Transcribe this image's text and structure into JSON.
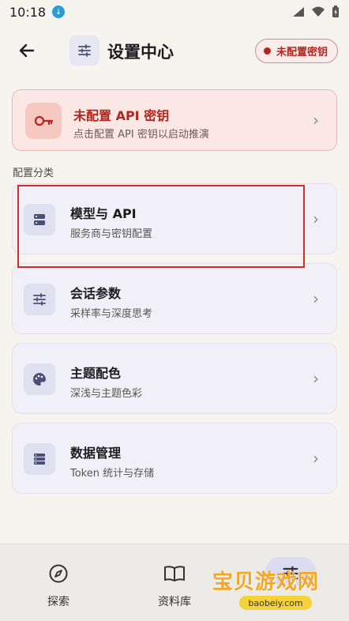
{
  "status_bar": {
    "time": "10:18"
  },
  "app_bar": {
    "title": "设置中心",
    "status_pill": "未配置密钥"
  },
  "warning": {
    "title": "未配置 API 密钥",
    "subtitle": "点击配置 API 密钥以启动推演"
  },
  "section_label": "配置分类",
  "categories": [
    {
      "title": "模型与 API",
      "subtitle": "服务商与密钥配置",
      "icon": "server-icon"
    },
    {
      "title": "会话参数",
      "subtitle": "采样率与深度思考",
      "icon": "sliders-icon"
    },
    {
      "title": "主题配色",
      "subtitle": "深浅与主题色彩",
      "icon": "palette-icon"
    },
    {
      "title": "数据管理",
      "subtitle": "Token 统计与存储",
      "icon": "storage-icon"
    }
  ],
  "bottom_nav": {
    "items": [
      {
        "label": "探索",
        "icon": "compass-icon"
      },
      {
        "label": "资料库",
        "icon": "book-icon"
      },
      {
        "label": "设置",
        "icon": "settings-sliders-icon",
        "active": true
      }
    ]
  },
  "watermark": {
    "text": "宝贝游戏网",
    "url": "baobeiy.com"
  },
  "colors": {
    "accent": "#b3261e",
    "card": "#f1f0f8",
    "background": "#f6f4ef"
  }
}
